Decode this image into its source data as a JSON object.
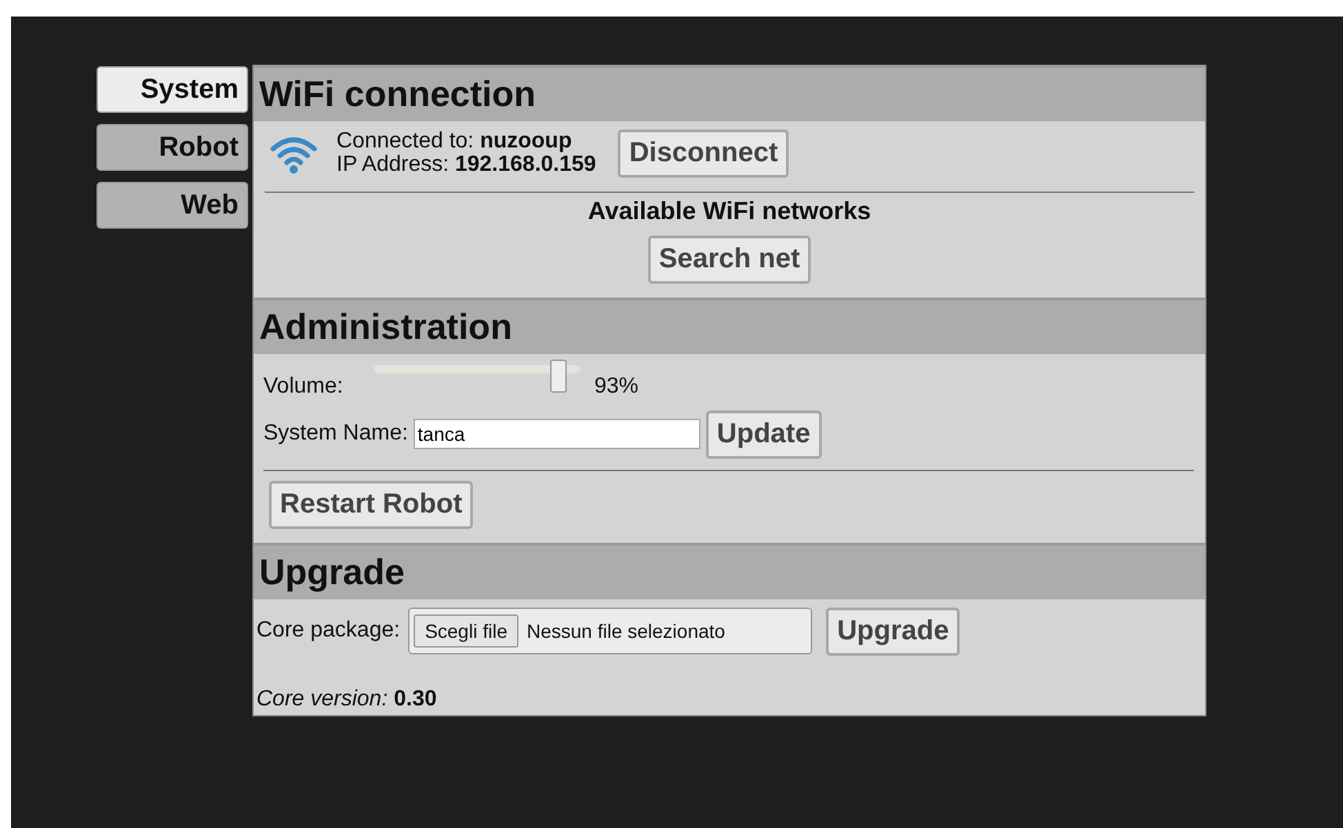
{
  "tabs": [
    {
      "label": "System",
      "selected": true
    },
    {
      "label": "Robot",
      "selected": false
    },
    {
      "label": "Web",
      "selected": false
    }
  ],
  "wifi": {
    "title": "WiFi connection",
    "connected_label": "Connected to:",
    "network": "nuzooup",
    "ip_label": "IP Address:",
    "ip": "192.168.0.159",
    "disconnect_button": "Disconnect",
    "networks_title": "Available WiFi networks",
    "search_button": "Search net"
  },
  "administration": {
    "title": "Administration",
    "volume": {
      "label": "Volume:",
      "level": 0.93,
      "reading": "93%"
    },
    "system_name": {
      "label": "System Name:",
      "value": "tanca"
    },
    "update_button": "Update",
    "restart_button": "Restart Robot"
  },
  "upgrade": {
    "title": "Upgrade",
    "file": {
      "label": "Core package:",
      "choose_button": "Scegli file",
      "status": "Nessun file selezionato"
    },
    "upgrade_button": "Upgrade",
    "version_label": "Core version:",
    "version": "0.30"
  }
}
